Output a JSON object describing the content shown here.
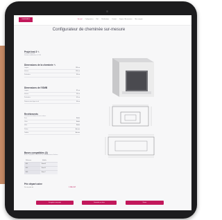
{
  "nav": {
    "logo": "CHEMINÉES",
    "items": [
      "Accueil",
      "Configurateur",
      "Réf.",
      "Réalisations",
      "Contact",
      "Foyers / Accessoires",
      "Mon compte"
    ],
    "active_index": 0
  },
  "page_title": "Configurateur de cheminée sur-mesure",
  "project": {
    "title": "Projet test 3",
    "lines": [
      "Créé le 12/06/2024",
      "Dernière modification le 12/06"
    ]
  },
  "dimensions": {
    "title": "Dimensions de la cheminée",
    "rows": [
      [
        "Largeur",
        "180 cm"
      ],
      [
        "Hauteur",
        "100 cm"
      ],
      [
        "Profondeur",
        "60 cm"
      ]
    ]
  },
  "foyer": {
    "title": "Dimensions de l'ISMB",
    "rows": [
      [
        "Largeur",
        "82 cm"
      ],
      [
        "Hauteur",
        "56 cm"
      ],
      [
        "Profondeur",
        "45 cm"
      ],
      [
        "Distance entre foyer et sol",
        "40 cm"
      ]
    ]
  },
  "revetements": {
    "title": "Revêtements",
    "subtitle": "Choisissez les finitions de vos surfaces",
    "rows": [
      [
        "Face",
        "Enduit"
      ],
      [
        "Côtés",
        "Enduit"
      ],
      [
        "Hotte",
        "Enduit"
      ],
      [
        "Plinthe",
        "Aucune"
      ],
      [
        "Tablette",
        "Aucune"
      ]
    ]
  },
  "bases": {
    "title": "Bases compatibles (3)",
    "subtitle": "Bases compatibles en fonction de vos dimensions et finitions",
    "headers": [
      "Référence",
      "Modèle"
    ],
    "rows": [
      [
        "B01",
        "Base A"
      ],
      [
        "B02",
        "Base B"
      ],
      [
        "B03",
        "Base C"
      ]
    ]
  },
  "price": {
    "title": "Prix départ usine",
    "label": "Prix à partir de",
    "value": "1 274 € HT"
  },
  "buttons": [
    "Enregistrer mon projet",
    "Demander un devis",
    "Retour"
  ],
  "colors": {
    "accent": "#c2185b",
    "tablet": "#1c1c1e",
    "page": "#f7f7f8"
  }
}
